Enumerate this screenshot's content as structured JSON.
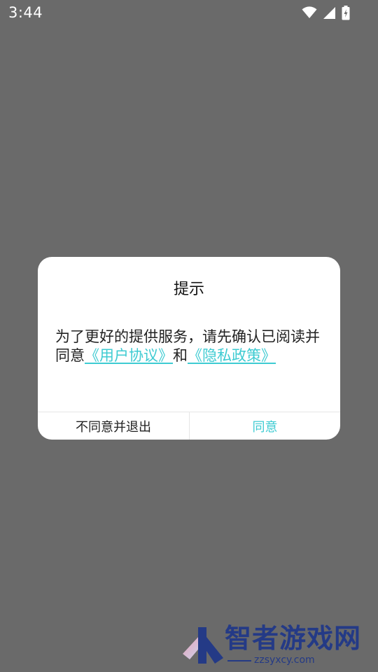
{
  "status_bar": {
    "time": "3:44",
    "icons": [
      "wifi-icon",
      "signal-icon",
      "battery-charging-icon"
    ]
  },
  "dialog": {
    "title": "提示",
    "message_prefix": "为了更好的提供服务，请先确认已阅读并同意",
    "user_agreement_link": "《用户协议》",
    "conjunction": "和",
    "privacy_policy_link": "《隐私政策》",
    "buttons": {
      "disagree": "不同意并退出",
      "agree": "同意"
    }
  },
  "watermark": {
    "site_name": "智者游戏网",
    "url": "zzsyxcy.com"
  },
  "colors": {
    "background_overlay": "#6a6a6a",
    "dialog_background": "#ffffff",
    "accent": "#3ecbd2",
    "text_primary": "#222222",
    "watermark": "#243a86"
  }
}
